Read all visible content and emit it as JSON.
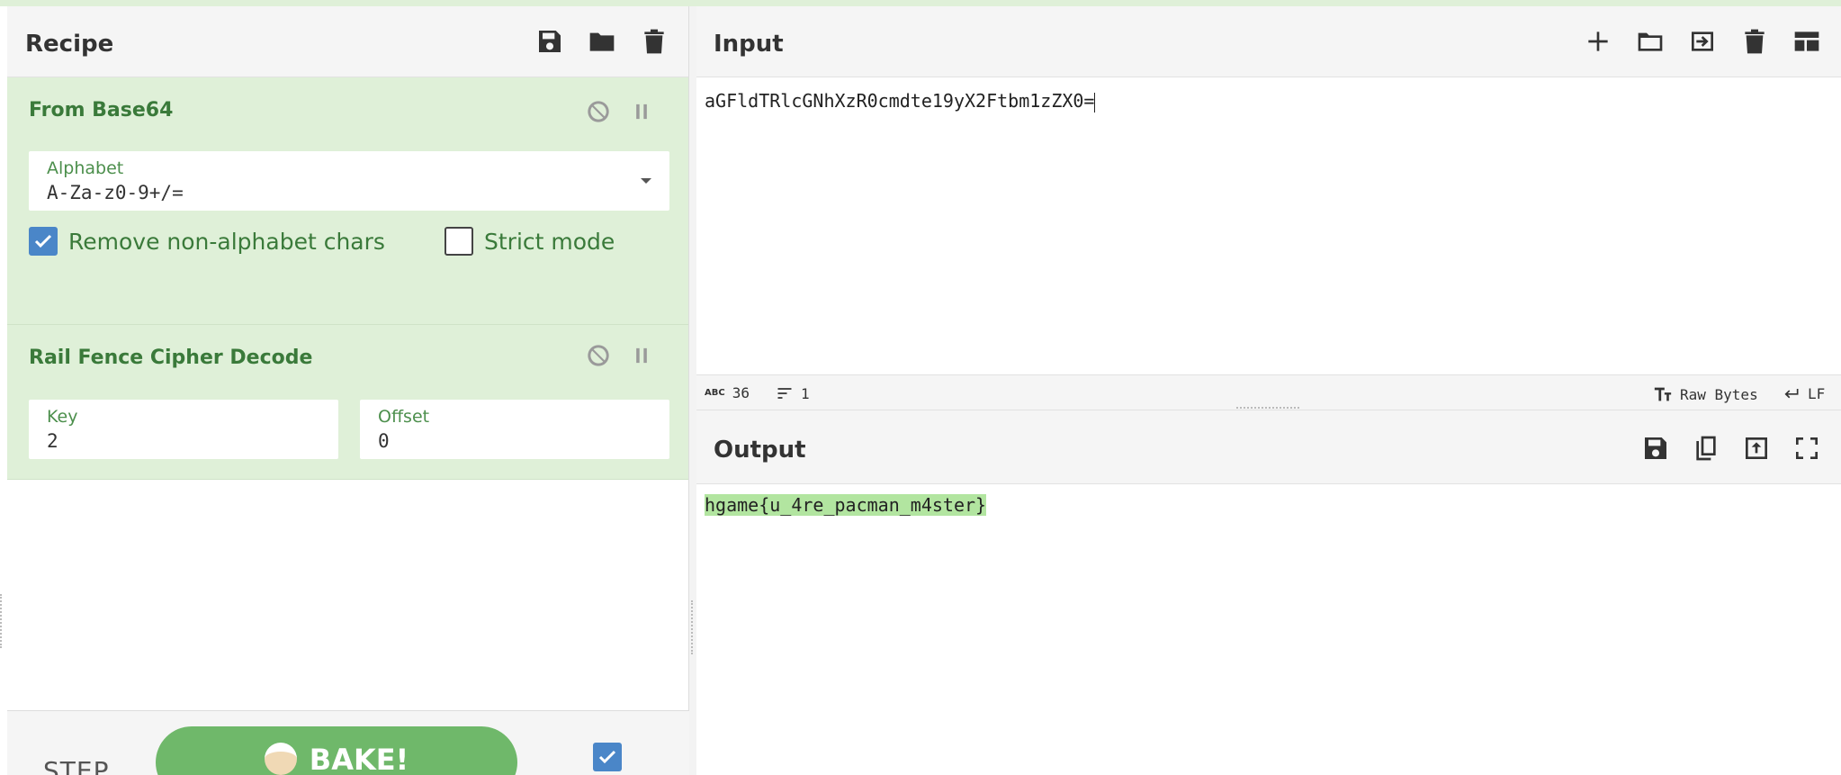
{
  "recipe": {
    "title": "Recipe",
    "icons": [
      "save-icon",
      "folder-icon",
      "trash-icon"
    ],
    "operations": [
      {
        "title": "From Base64",
        "alphabet_label": "Alphabet",
        "alphabet_value": "A-Za-z0-9+/=",
        "remove_nonalpha_label": "Remove non-alphabet chars",
        "remove_nonalpha_checked": true,
        "strict_label": "Strict mode",
        "strict_checked": false
      },
      {
        "title": "Rail Fence Cipher Decode",
        "key_label": "Key",
        "key_value": "2",
        "offset_label": "Offset",
        "offset_value": "0"
      }
    ],
    "step_label": "STEP",
    "bake_label": "BAKE!",
    "autobake_checked": true
  },
  "input": {
    "title": "Input",
    "icons": [
      "plus-icon",
      "folder-icon",
      "input-icon",
      "trash-icon",
      "layout-icon"
    ],
    "value": "aGFldTRlcGNhXzR0cmdte19yX2Ftbm1zZX0=",
    "status": {
      "length": "36",
      "lines": "1",
      "encoding": "Raw Bytes",
      "eol": "LF"
    }
  },
  "output": {
    "title": "Output",
    "icons": [
      "save-icon",
      "copy-icon",
      "replace-input-icon",
      "fullscreen-icon"
    ],
    "value": "hgame{u_4re_pacman_m4ster}"
  },
  "colors": {
    "op_bg": "#dff0d8",
    "op_title": "#3a7a3a",
    "bake": "#6fb86a",
    "highlight": "#b2e5a0",
    "check": "#4a86c8"
  }
}
